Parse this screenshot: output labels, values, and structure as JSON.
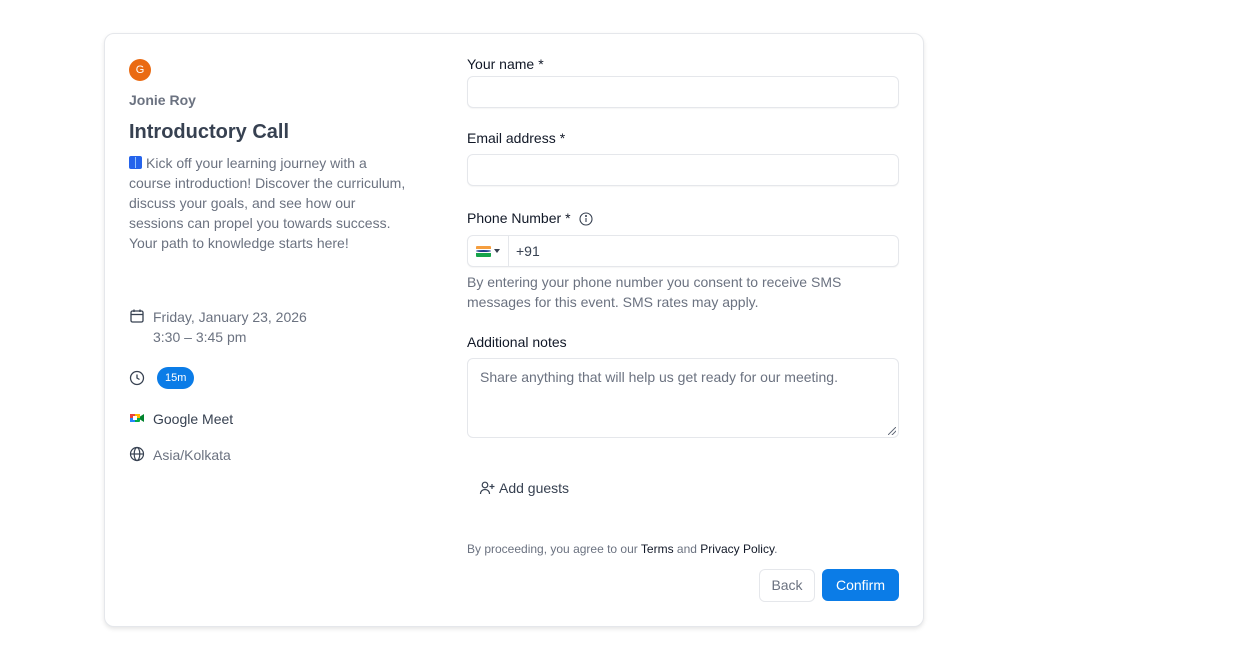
{
  "event": {
    "host_initial": "G",
    "host_name": "Jonie Roy",
    "title": "Introductory Call",
    "description": "Kick off your learning journey with a course introduction! Discover the curriculum, discuss your goals, and see how our sessions can propel you towards success. Your path to knowledge starts here!",
    "date": "Friday, January 23, 2026",
    "time": "3:30 – 3:45 pm",
    "duration": "15m",
    "location": "Google Meet",
    "timezone": "Asia/Kolkata"
  },
  "form": {
    "name_label": "Your name",
    "email_label": "Email address",
    "phone_label": "Phone Number",
    "required_mark": "*",
    "phone_country_code": "+91",
    "phone_helper": "By entering your phone number you consent to receive SMS messages for this event. SMS rates may apply.",
    "notes_label": "Additional notes",
    "notes_placeholder": "Share anything that will help us get ready for our meeting.",
    "add_guests": "Add guests",
    "terms_prefix": "By proceeding, you agree to our ",
    "terms_link": "Terms",
    "terms_and": " and ",
    "privacy_link": "Privacy Policy",
    "terms_suffix": ".",
    "back_button": "Back",
    "confirm_button": "Confirm"
  },
  "colors": {
    "accent": "#0b7ce7",
    "avatar": "#ea6a12"
  },
  "icons": {
    "date": "calendar-icon",
    "duration": "clock-icon",
    "location": "google-meet-icon",
    "timezone": "globe-icon",
    "phone_info": "info-icon",
    "guests": "add-user-icon",
    "flag": "india-flag-icon"
  }
}
